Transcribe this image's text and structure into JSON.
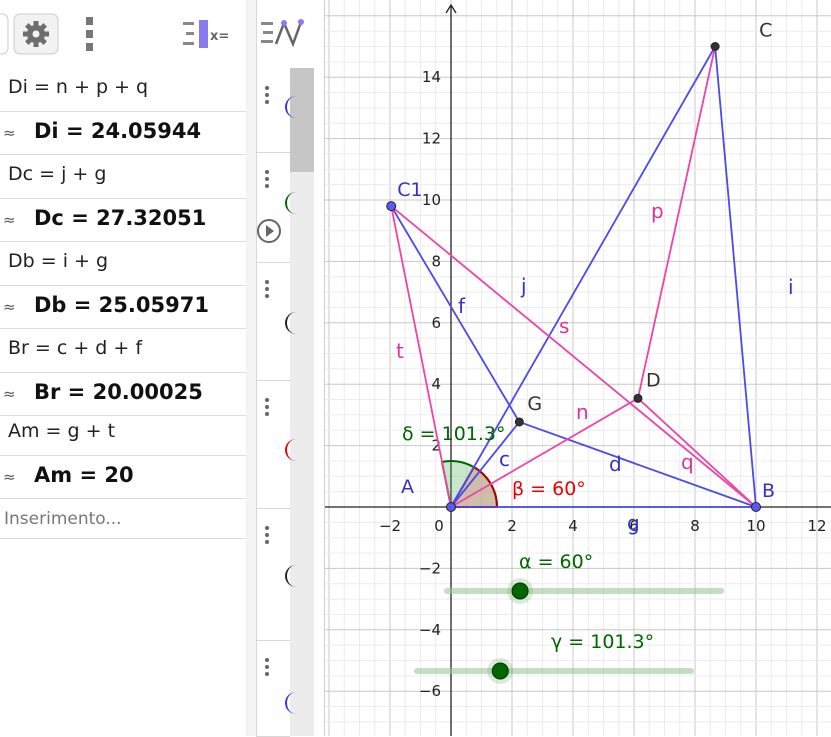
{
  "algebra": {
    "rows": [
      {
        "definition": "Di = n + p + q",
        "value": "Di = 24.05944"
      },
      {
        "definition": "Dc = j + g",
        "value": "Dc = 27.32051"
      },
      {
        "definition": "Db = i + g",
        "value": "Db = 25.05971"
      },
      {
        "definition": "Br = c + d + f",
        "value": "Br = 20.00025"
      },
      {
        "definition": "Am = g + t",
        "value": "Am = 20"
      }
    ],
    "approx_symbol": "≈",
    "input_placeholder": "Inserimento..."
  },
  "toolbar": {
    "settings_icon": "gear-icon",
    "menu_icon": "vertical-dots-icon",
    "algebra_view_icon": "algebra-view-icon",
    "graphics_icon": "graph-view-icon",
    "x_label": "x="
  },
  "graphics": {
    "x_ticks": [
      "−2",
      "0",
      "2",
      "4",
      "6",
      "8",
      "10",
      "12"
    ],
    "y_ticks": [
      "14",
      "12",
      "10",
      "8",
      "6",
      "4",
      "2",
      "−2",
      "−4",
      "−6"
    ],
    "points": [
      {
        "name": "A",
        "x": 0,
        "y": 0
      },
      {
        "name": "B",
        "x": 10,
        "y": 0
      },
      {
        "name": "C",
        "x": 8.66,
        "y": 15
      },
      {
        "name": "C1",
        "x": -1.96,
        "y": 9.8
      },
      {
        "name": "D",
        "x": 6.13,
        "y": 3.54
      },
      {
        "name": "G",
        "x": 2.24,
        "y": 2.77
      }
    ],
    "segment_labels": [
      {
        "name": "f",
        "color": "#3333cc"
      },
      {
        "name": "j",
        "color": "#3333cc"
      },
      {
        "name": "i",
        "color": "#3333cc"
      },
      {
        "name": "c",
        "color": "#3333cc"
      },
      {
        "name": "d",
        "color": "#3333cc"
      },
      {
        "name": "g",
        "color": "#3333cc"
      },
      {
        "name": "p",
        "color": "#dd3399"
      },
      {
        "name": "s",
        "color": "#dd3399"
      },
      {
        "name": "t",
        "color": "#dd3399"
      },
      {
        "name": "n",
        "color": "#dd3399"
      },
      {
        "name": "q",
        "color": "#dd3399"
      }
    ],
    "angle_delta": "δ = 101.3°",
    "angle_beta": "β = 60°",
    "slider_alpha": {
      "label": "α = 60°",
      "value": 60
    },
    "slider_gamma": {
      "label": "γ = 101.3°",
      "value": 101.3
    },
    "colors": {
      "blue": "#4a4aee",
      "pink": "#ee44aa",
      "green": "#006600",
      "red": "#ee0000"
    }
  }
}
